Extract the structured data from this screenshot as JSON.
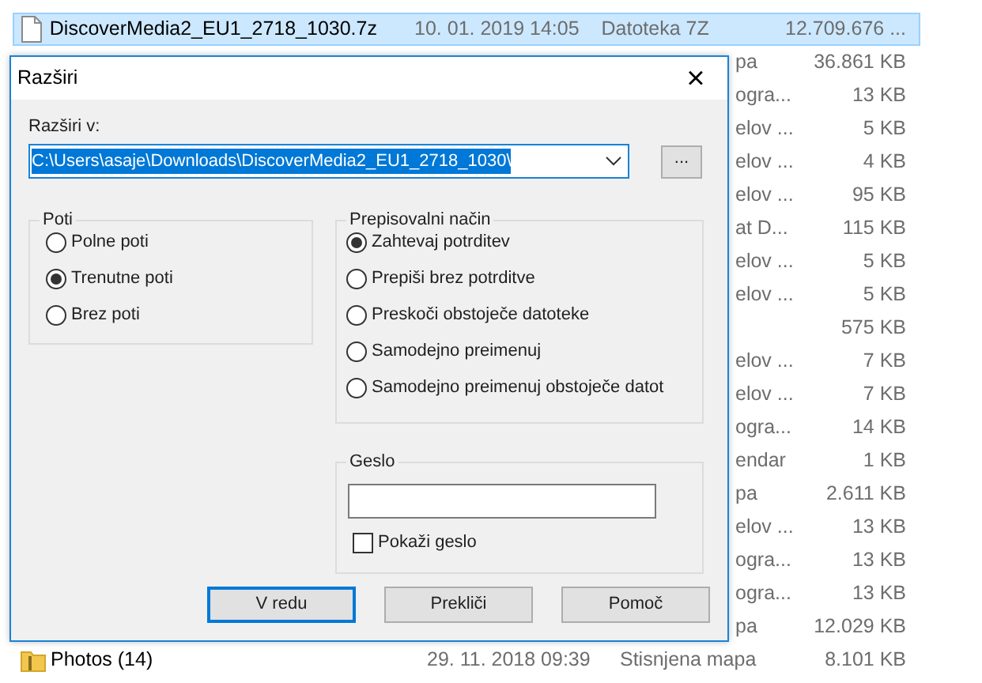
{
  "file_list": {
    "rows": [
      {
        "kind": "file",
        "name": "DiscoverMedia2_EU1_2718_1030.7z",
        "date": "10. 01. 2019 14:05",
        "type": "Datoteka 7Z",
        "size": "12.709.676 ...",
        "selected": true
      },
      {
        "kind": "covered",
        "type": "pa",
        "size": "36.861 KB",
        "selected": false
      },
      {
        "kind": "covered",
        "type": "ogra...",
        "size": "13 KB",
        "selected": false
      },
      {
        "kind": "covered",
        "type": "elov ...",
        "size": "5 KB",
        "selected": false
      },
      {
        "kind": "covered",
        "type": "elov ...",
        "size": "4 KB",
        "selected": false
      },
      {
        "kind": "covered",
        "type": "elov ...",
        "size": "95 KB",
        "selected": false
      },
      {
        "kind": "covered",
        "type": "at D...",
        "size": "115 KB",
        "selected": false
      },
      {
        "kind": "covered",
        "type": "elov ...",
        "size": "5 KB",
        "selected": false
      },
      {
        "kind": "covered",
        "type": "elov ...",
        "size": "5 KB",
        "selected": false
      },
      {
        "kind": "covered",
        "size": "575 KB",
        "selected": false
      },
      {
        "kind": "covered",
        "type": "elov ...",
        "size": "7 KB",
        "selected": false
      },
      {
        "kind": "covered",
        "type": "elov ...",
        "size": "7 KB",
        "selected": false
      },
      {
        "kind": "covered",
        "type": "ogra...",
        "size": "14 KB",
        "selected": false
      },
      {
        "kind": "covered",
        "type": "endar",
        "size": "1 KB",
        "selected": false
      },
      {
        "kind": "covered",
        "type": "pa",
        "size": "2.611 KB",
        "selected": false
      },
      {
        "kind": "covered",
        "type": "elov ...",
        "size": "13 KB",
        "selected": false
      },
      {
        "kind": "covered",
        "type": "ogra...",
        "size": "13 KB",
        "selected": false
      },
      {
        "kind": "covered",
        "type": "ogra...",
        "size": "13 KB",
        "selected": false
      },
      {
        "kind": "covered",
        "type": "pa",
        "size": "12.029 KB",
        "selected": false
      },
      {
        "kind": "zip",
        "name": "Photos (14)",
        "date": "29. 11. 2018 09:39",
        "type": "Stisnjena mapa",
        "size": "8.101 KB",
        "selected": false
      }
    ]
  },
  "dialog": {
    "title": "Razširi",
    "close": "×",
    "destination": {
      "label": "Razširi v:",
      "value": "C:\\Users\\asaje\\Downloads\\DiscoverMedia2_EU1_2718_1030\\",
      "text_selected": true
    },
    "browse_button": "...",
    "paths": {
      "title": "Poti",
      "options": [
        {
          "label": "Polne poti",
          "selected": false
        },
        {
          "label": "Trenutne poti",
          "selected": true
        },
        {
          "label": "Brez poti",
          "selected": false
        }
      ]
    },
    "overwrite": {
      "title": "Prepisovalni način",
      "options": [
        {
          "label": "Zahtevaj potrditev",
          "selected": true
        },
        {
          "label": "Prepiši brez potrditve",
          "selected": false
        },
        {
          "label": "Preskoči obstoječe datoteke",
          "selected": false
        },
        {
          "label": "Samodejno preimenuj",
          "selected": false
        },
        {
          "label": "Samodejno preimenuj obstoječe datot",
          "selected": false
        }
      ]
    },
    "password": {
      "title": "Geslo",
      "show_password": {
        "label": "Pokaži geslo",
        "checked": false
      }
    },
    "buttons": [
      {
        "label": "V redu",
        "default": true
      },
      {
        "label": "Prekliči",
        "default": false
      },
      {
        "label": "Pomoč",
        "default": false
      }
    ]
  }
}
